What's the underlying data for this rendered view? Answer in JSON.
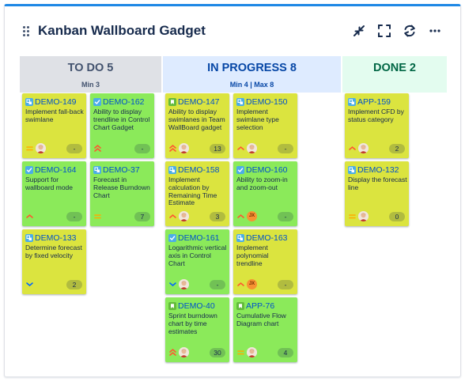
{
  "gadget": {
    "title": "Kanban Wallboard Gadget",
    "actions": [
      "minimize-icon",
      "fullscreen-icon",
      "refresh-icon",
      "more-icon"
    ]
  },
  "columns": [
    {
      "title": "TO DO 5",
      "subtitle": "Min 3",
      "color": "#dfe1e6"
    },
    {
      "title": "IN PROGRESS 8",
      "subtitle": "Min 4 | Max 8",
      "color": "#deebff"
    },
    {
      "title": "DONE 2",
      "subtitle": "",
      "color": "#e3fcef"
    }
  ],
  "colors": {
    "story_card": "#dbe43f",
    "done_card": "#8bea5a",
    "key": "#0052cc",
    "header_accent": "#1e88e5"
  },
  "cards": [
    {
      "key": "DEMO-149",
      "summary": "Implement fall-back swimlane",
      "type": "subtask",
      "priority": "medium",
      "assignee": "photo",
      "estimate": "-",
      "color": "yellow"
    },
    {
      "key": "DEMO-162",
      "summary": "Ability to display trendline in Control Chart Gadget",
      "type": "task",
      "priority": "highest",
      "assignee": "",
      "estimate": "-",
      "color": "green"
    },
    {
      "key": "DEMO-164",
      "summary": "Support for wallboard mode",
      "type": "task",
      "priority": "high",
      "assignee": "",
      "estimate": "-",
      "color": "green"
    },
    {
      "key": "DEMO-37",
      "summary": "Forecast in Release Burndown Chart",
      "type": "subtask",
      "priority": "medium",
      "assignee": "",
      "estimate": "7",
      "color": "green"
    },
    {
      "key": "DEMO-133",
      "summary": "Determine forecast by fixed velocity",
      "type": "subtask",
      "priority": "low",
      "assignee": "",
      "estimate": "2",
      "color": "yellow"
    },
    {
      "key": "DEMO-147",
      "summary": "Ability to display swimlanes in Team WallBoard gadget",
      "type": "story",
      "priority": "highest",
      "assignee": "photo",
      "estimate": "13",
      "color": "yellow"
    },
    {
      "key": "DEMO-150",
      "summary": "Implement swimlane type selection",
      "type": "subtask",
      "priority": "high",
      "assignee": "photo",
      "estimate": "-",
      "color": "yellow"
    },
    {
      "key": "DEMO-158",
      "summary": "Implement calculation by Remaining Time Estimate",
      "type": "subtask",
      "priority": "high",
      "assignee": "photo",
      "estimate": "3",
      "color": "yellow"
    },
    {
      "key": "DEMO-160",
      "summary": "Ability to zoom-in and zoom-out",
      "type": "task",
      "priority": "high",
      "assignee": "JX",
      "estimate": "-",
      "color": "green"
    },
    {
      "key": "DEMO-161",
      "summary": "Logarithmic vertical axis in Control Chart",
      "type": "task",
      "priority": "low",
      "assignee": "photo",
      "estimate": "-",
      "color": "green"
    },
    {
      "key": "DEMO-163",
      "summary": "Implement polynomial trendline",
      "type": "subtask",
      "priority": "high",
      "assignee": "JX",
      "estimate": "-",
      "color": "yellow"
    },
    {
      "key": "DEMO-40",
      "summary": "Sprint burndown chart by time estimates",
      "type": "story",
      "priority": "highest",
      "assignee": "photo",
      "estimate": "30",
      "color": "green"
    },
    {
      "key": "APP-76",
      "summary": "Cumulative Flow Diagram chart",
      "type": "story",
      "priority": "medium",
      "assignee": "photo",
      "estimate": "4",
      "color": "green"
    },
    {
      "key": "APP-159",
      "summary": "Implement CFD by status category",
      "type": "subtask",
      "priority": "high",
      "assignee": "photo",
      "estimate": "2",
      "color": "yellow"
    },
    {
      "key": "DEMO-132",
      "summary": "Display the forecast line",
      "type": "subtask",
      "priority": "medium",
      "assignee": "photo",
      "estimate": "0",
      "color": "yellow"
    }
  ]
}
